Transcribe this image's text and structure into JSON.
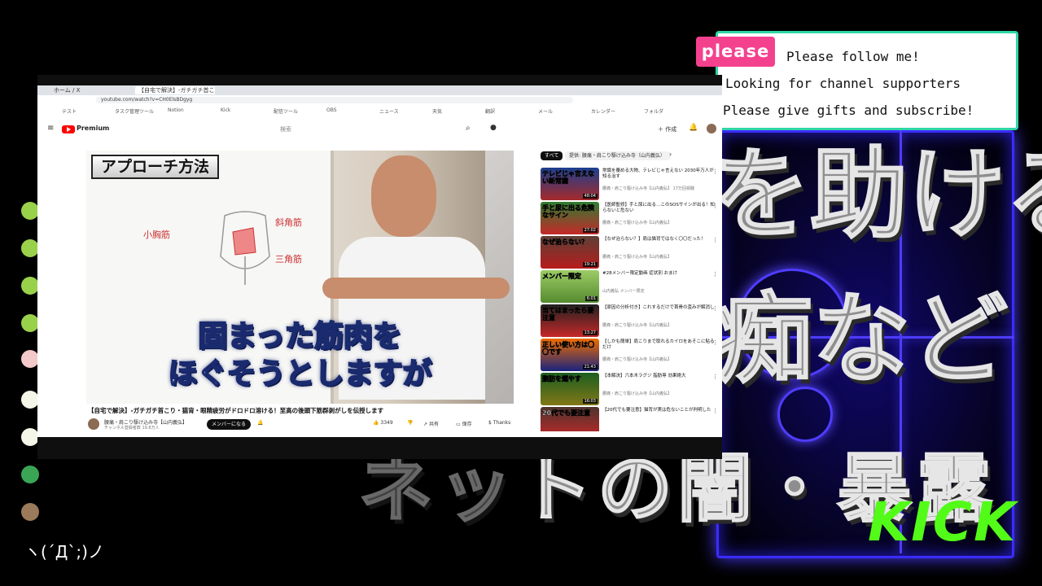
{
  "overlay": {
    "please_badge": "please",
    "please_lines": [
      "Please follow me!",
      "Looking for channel supporters",
      "Please give gifts and subscribe!"
    ],
    "big_lines": [
      "を助ける",
      "痴など・・・",
      "ネットの闇・暴露"
    ],
    "kick_logo": "KICK",
    "chat_kaomoji": "ヽ(´Д`;)ノ",
    "colors": {
      "accent_pink": "#f4418e",
      "kick_green": "#53fc18",
      "neon_blue": "#3b2cff",
      "border_teal": "#2fd6a8"
    }
  },
  "browser": {
    "tabs": [
      "ホーム / X",
      "【自宅で解決】-ガチガチ首こり..."
    ],
    "url": "youtube.com/watch?v=CH0ElsBDgyg",
    "bookmarks": [
      "テスト",
      "タスク管理ツール",
      "Notion",
      "Kick",
      "配信ツール",
      "OBS",
      "ニュース",
      "天気",
      "翻訳",
      "メール",
      "カレンダー",
      "フォルダ"
    ]
  },
  "youtube": {
    "premium_label": "Premium",
    "search_placeholder": "検索",
    "create_label": "作成",
    "video": {
      "tag": "アプローチ方法",
      "subtitle_1": "固まった筋肉を",
      "subtitle_2": "ほぐそうとしますが",
      "board_notes": [
        "小胸筋",
        "斜角筋",
        "三角筋"
      ]
    },
    "title": "【自宅で解決】-ガチガチ首こり・猫背・眼精疲労がドロドロ溶ける！至高の後頭下筋群剥がしを伝授します",
    "channel": {
      "name": "腰痛・肩こり駆け込み寺【山内義弘】",
      "subs": "チャンネル登録者数 19.8万人",
      "join": "メンバーになる"
    },
    "actions": {
      "like": "3349",
      "share": "共有",
      "save": "保存",
      "thanks": "Thanks"
    },
    "chips": [
      "すべて",
      "提供: 腰痛・肩こり駆け込み寺（山内義弘）"
    ],
    "recommendations": [
      {
        "thumb": "テレビじゃ言えない新常識",
        "duration": "48:04",
        "title": "常識を覆める大物、テレビじゃ言えない 2030年万人が知る治す",
        "meta": "腰痛・肩こり駆け込み寺【山内義弘】 17万回視聴"
      },
      {
        "thumb": "手と尿に出る危険なサイン",
        "duration": "27:02",
        "title": "【医師監修】手と尿に出る…このSOSサインが出る！知らないと危ない",
        "meta": "腰痛・肩こり駆け込み寺【山内義弘】"
      },
      {
        "thumb": "なぜ治らない？",
        "duration": "19:21",
        "title": "【なぜ治らない？】肩は猫背ではなく〇〇だった！",
        "meta": "腰痛・肩こり駆け込み寺【山内義弘】"
      },
      {
        "thumb": "メンバー限定",
        "duration": "6:01",
        "title": "#28メンバー限定動画 症状別 おまけ",
        "meta": "山内義弘 メンバー限定"
      },
      {
        "thumb": "当てはまったら要注意",
        "duration": "13:27",
        "title": "【原因の分析付き】これするだけで首骨の歪みが解消し",
        "meta": "腰痛・肩こり駆け込み寺【山内義弘】"
      },
      {
        "thumb": "正しい使い方は〇〇です",
        "duration": "21:43",
        "title": "【しかも簡単】肩こりまで取れるカイロをあそこに貼るだけ",
        "meta": "腰痛・肩こり駆け込み寺【山内義弘】"
      },
      {
        "thumb": "脂肪を燃やす",
        "duration": "16:03",
        "title": "【本解決】六本木ラグジ 脂肪専 効果絶大",
        "meta": "腰痛・肩こり駆け込み寺【山内義弘】"
      },
      {
        "thumb": "20代でも要注意",
        "duration": "",
        "title": "【20代でも要注意】猫背が実は危ないことが判明した",
        "meta": ""
      }
    ]
  }
}
